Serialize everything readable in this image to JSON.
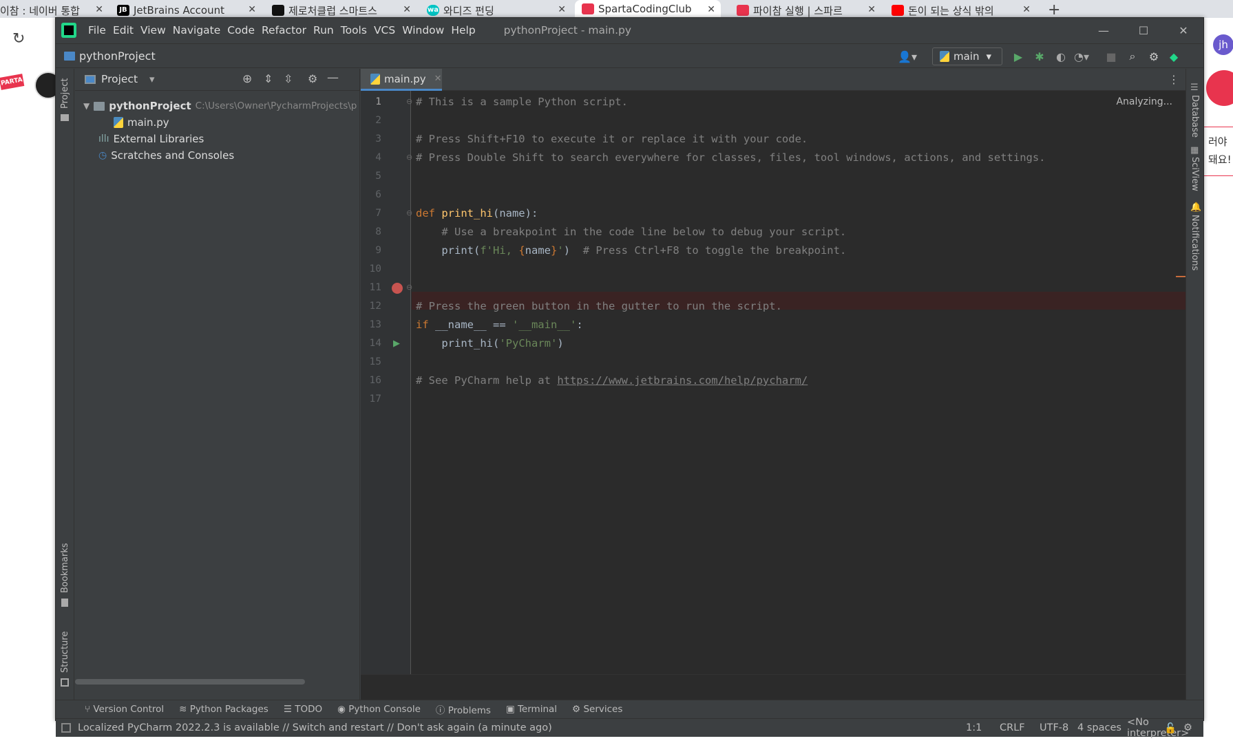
{
  "browser": {
    "tabs": [
      {
        "label": "이참 : 네이버 통합"
      },
      {
        "label": "JetBrains Account"
      },
      {
        "label": "제로처클럽 스마트스"
      },
      {
        "label": "와디즈 펀딩"
      },
      {
        "label": "SpartaCodingClub"
      },
      {
        "label": "파이참 실행 | 스파르"
      },
      {
        "label": "돈이 되는 상식 밖의"
      }
    ],
    "side_text_1": "러야",
    "side_text_2": "돼요!",
    "profile": "jh"
  },
  "ide": {
    "menu": [
      "File",
      "Edit",
      "View",
      "Navigate",
      "Code",
      "Refactor",
      "Run",
      "Tools",
      "VCS",
      "Window",
      "Help"
    ],
    "window_title": "pythonProject - main.py",
    "breadcrumb": "pythonProject",
    "run_config": "main",
    "left_stripe": {
      "project": "Project",
      "bookmarks": "Bookmarks",
      "structure": "Structure"
    },
    "right_stripe": {
      "database": "Database",
      "sciview": "SciView",
      "notifications": "Notifications"
    },
    "project_panel": {
      "title": "Project",
      "root": "pythonProject",
      "root_path": "C:\\Users\\Owner\\PycharmProjects\\p",
      "items": [
        "main.py",
        "External Libraries",
        "Scratches and Consoles"
      ]
    },
    "editor": {
      "tab": "main.py",
      "analyzing": "Analyzing...",
      "line_numbers": [
        "1",
        "2",
        "3",
        "4",
        "5",
        "6",
        "7",
        "8",
        "9",
        "10",
        "11",
        "12",
        "13",
        "14",
        "15",
        "16",
        "17"
      ]
    },
    "bottom_tools": [
      "Version Control",
      "Python Packages",
      "TODO",
      "Python Console",
      "Problems",
      "Terminal",
      "Services"
    ],
    "status": {
      "message": "Localized PyCharm 2022.2.3 is available // Switch and restart // Don't ask again (a minute ago)",
      "position": "1:1",
      "line_sep": "CRLF",
      "encoding": "UTF-8",
      "indent": "4 spaces",
      "interpreter": "<No interpreter>"
    }
  }
}
